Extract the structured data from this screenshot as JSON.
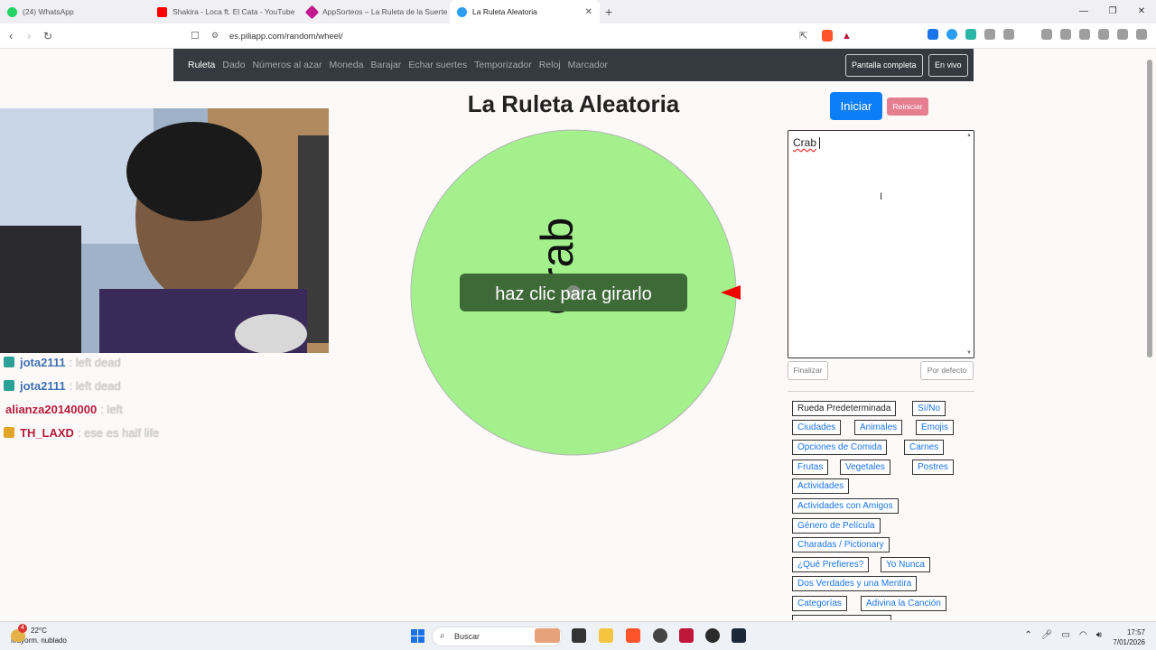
{
  "browser": {
    "tabs": [
      {
        "label": "(24) WhatsApp",
        "color": "#25d366"
      },
      {
        "label": "Shakira - Loca ft. El Cata - YouTube",
        "color": "#ff0000"
      },
      {
        "label": "AppSorteos – La Ruleta de la Suerte",
        "color": "#c2188f"
      },
      {
        "label": "La Ruleta Aleatoria",
        "color": "#2a9df4"
      }
    ],
    "url": "es.piliapp.com/random/wheel/"
  },
  "nav": {
    "links": [
      "Ruleta",
      "Dado",
      "Números al azar",
      "Moneda",
      "Barajar",
      "Echar suertes",
      "Temporizador",
      "Reloj",
      "Marcador"
    ],
    "fullscreen": "Pantalla completa",
    "live": "En vivo"
  },
  "main": {
    "title": "La Ruleta Aleatoria",
    "start_button": "Iniciar",
    "reset_button": "Reiniciar"
  },
  "wheel": {
    "entry": "Crab",
    "prompt": "haz clic para girarlo",
    "color": "#a3f08c"
  },
  "editor": {
    "text": "Crab",
    "finish_button": "Finalizar",
    "default_button": "Por defecto"
  },
  "presets": [
    "Rueda Predeterminada",
    "Sí/No",
    "Ciudades",
    "Animales",
    "Emojis",
    "Opciones de Comida",
    "Carnes",
    "Frutas",
    "Vegetales",
    "Postres",
    "Actividades",
    "Actividades con Amigos",
    "Género de Película",
    "Charadas / Pictionary",
    "¿Qué Prefieres?",
    "Yo Nunca",
    "Dos Verdades y una Mentira",
    "Categorías",
    "Adivina la Canción"
  ],
  "chat": [
    {
      "user": "jota2111",
      "message": ": left dead",
      "color": "#3f6fb0",
      "badge": "#2aa198"
    },
    {
      "user": "jota2111",
      "message": ": left dead",
      "color": "#3f6fb0",
      "badge": "#2aa198"
    },
    {
      "user": "alianza20140000",
      "message": ": left",
      "color": "#b31b3b",
      "badge": ""
    },
    {
      "user": "TH_LAXD",
      "message": ": ese es half life",
      "color": "#b31b3b",
      "badge": "#e0a526"
    }
  ],
  "taskbar": {
    "temperature": "22°C",
    "weather": "Mayorm. nublado",
    "notifications": "4",
    "search": "Buscar",
    "time": "17:57",
    "date": "7/01/2026"
  }
}
